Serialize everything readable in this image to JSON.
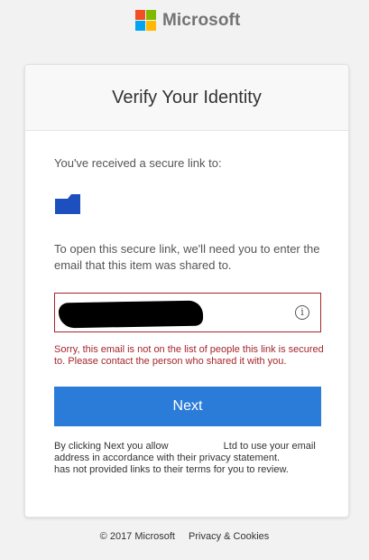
{
  "brand": {
    "name": "Microsoft",
    "colors": {
      "red": "#f25022",
      "green": "#7fba00",
      "blue": "#00a4ef",
      "yellow": "#ffb900"
    }
  },
  "card": {
    "title": "Verify Your Identity",
    "received_text": "You've received a secure link to:",
    "item_icon": "folder-icon",
    "instructions": "To open this secure link, we'll need you to enter the email that this item was shared to.",
    "email_input": {
      "value": "",
      "state": "error",
      "info_icon": "info-icon",
      "info_glyph": "i"
    },
    "error_message": "Sorry, this email is not on the list of people this link is secured to. Please contact the person who shared it with you.",
    "next_button": "Next",
    "disclaimer": "By clicking Next you allow                    Ltd to use your email address in accordance with their privacy statement.                          has not provided links to their terms for you to review."
  },
  "footer": {
    "copyright": "© 2017 Microsoft",
    "privacy_link": "Privacy & Cookies"
  },
  "colors": {
    "accent": "#2b7cd9",
    "error": "#a4262c",
    "folder": "#1e4fbf"
  }
}
